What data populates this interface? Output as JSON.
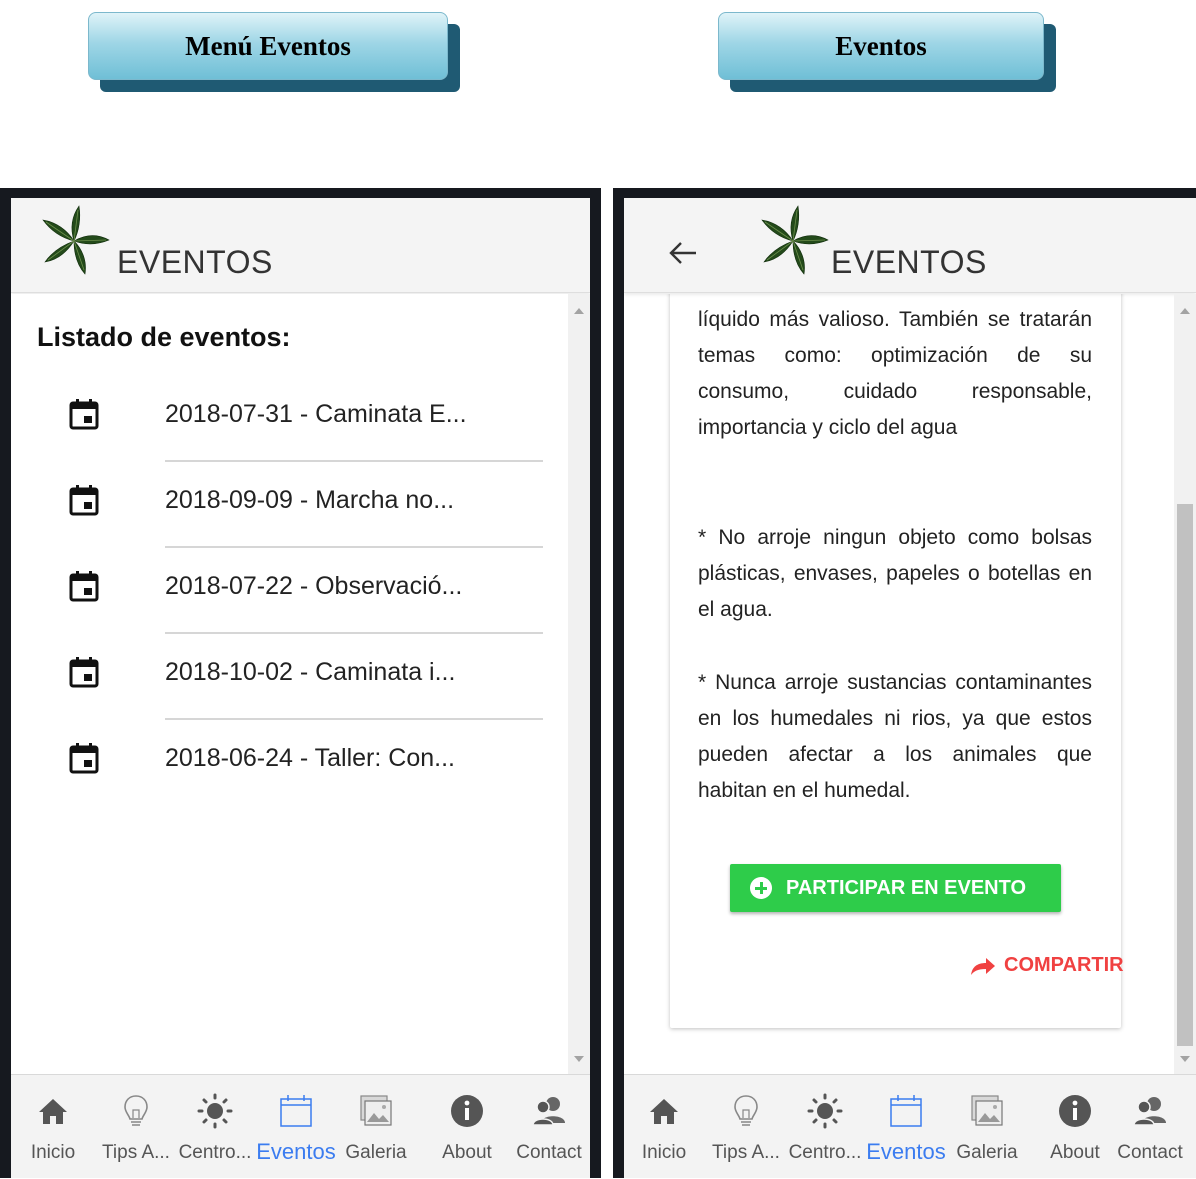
{
  "captions": {
    "left": "Menú Eventos",
    "right": "Eventos"
  },
  "colors": {
    "active_tab": "#3b7cf0",
    "participar_button": "#2ecc4a",
    "compartir_text": "#f04141",
    "frame": "#16191f",
    "caption_shadow": "#1f5a73"
  },
  "left_screen": {
    "appbar_title": "EVENTOS",
    "list_heading": "Listado de eventos:",
    "events": [
      {
        "icon": "calendar-icon",
        "label": "2018-07-31 - Caminata E..."
      },
      {
        "icon": "calendar-icon",
        "label": "2018-09-09 - Marcha no..."
      },
      {
        "icon": "calendar-icon",
        "label": "2018-07-22 - Observació..."
      },
      {
        "icon": "calendar-icon",
        "label": "2018-10-02 - Caminata i..."
      },
      {
        "icon": "calendar-icon",
        "label": "2018-06-24 - Taller: Con..."
      }
    ]
  },
  "right_screen": {
    "appbar_title": "EVENTOS",
    "back_icon": "arrow-left-icon",
    "paragraph_1": "líquido más valioso. También se tratarán temas como: optimización de su consumo, cuidado responsable, importancia y ciclo del agua",
    "paragraph_2": "* No arroje ningun objeto como bolsas plásticas, envases, papeles o botellas en el agua.",
    "paragraph_3": "* Nunca arroje sustancias contaminantes en los humedales ni rios, ya que estos pueden afectar a los animales que habitan en el humedal.",
    "participar_label": "PARTICIPAR EN EVENTO",
    "compartir_label": "COMPARTIR"
  },
  "nav": {
    "items": [
      {
        "icon": "home-icon",
        "label": "Inicio"
      },
      {
        "icon": "lightbulb-icon",
        "label": "Tips A..."
      },
      {
        "icon": "sun-icon",
        "label": "Centro..."
      },
      {
        "icon": "calendar-icon",
        "label": "Eventos",
        "active": true
      },
      {
        "icon": "gallery-icon",
        "label": "Galeria"
      },
      {
        "icon": "info-icon",
        "label": "About"
      },
      {
        "icon": "contacts-icon",
        "label": "Contact"
      }
    ]
  }
}
